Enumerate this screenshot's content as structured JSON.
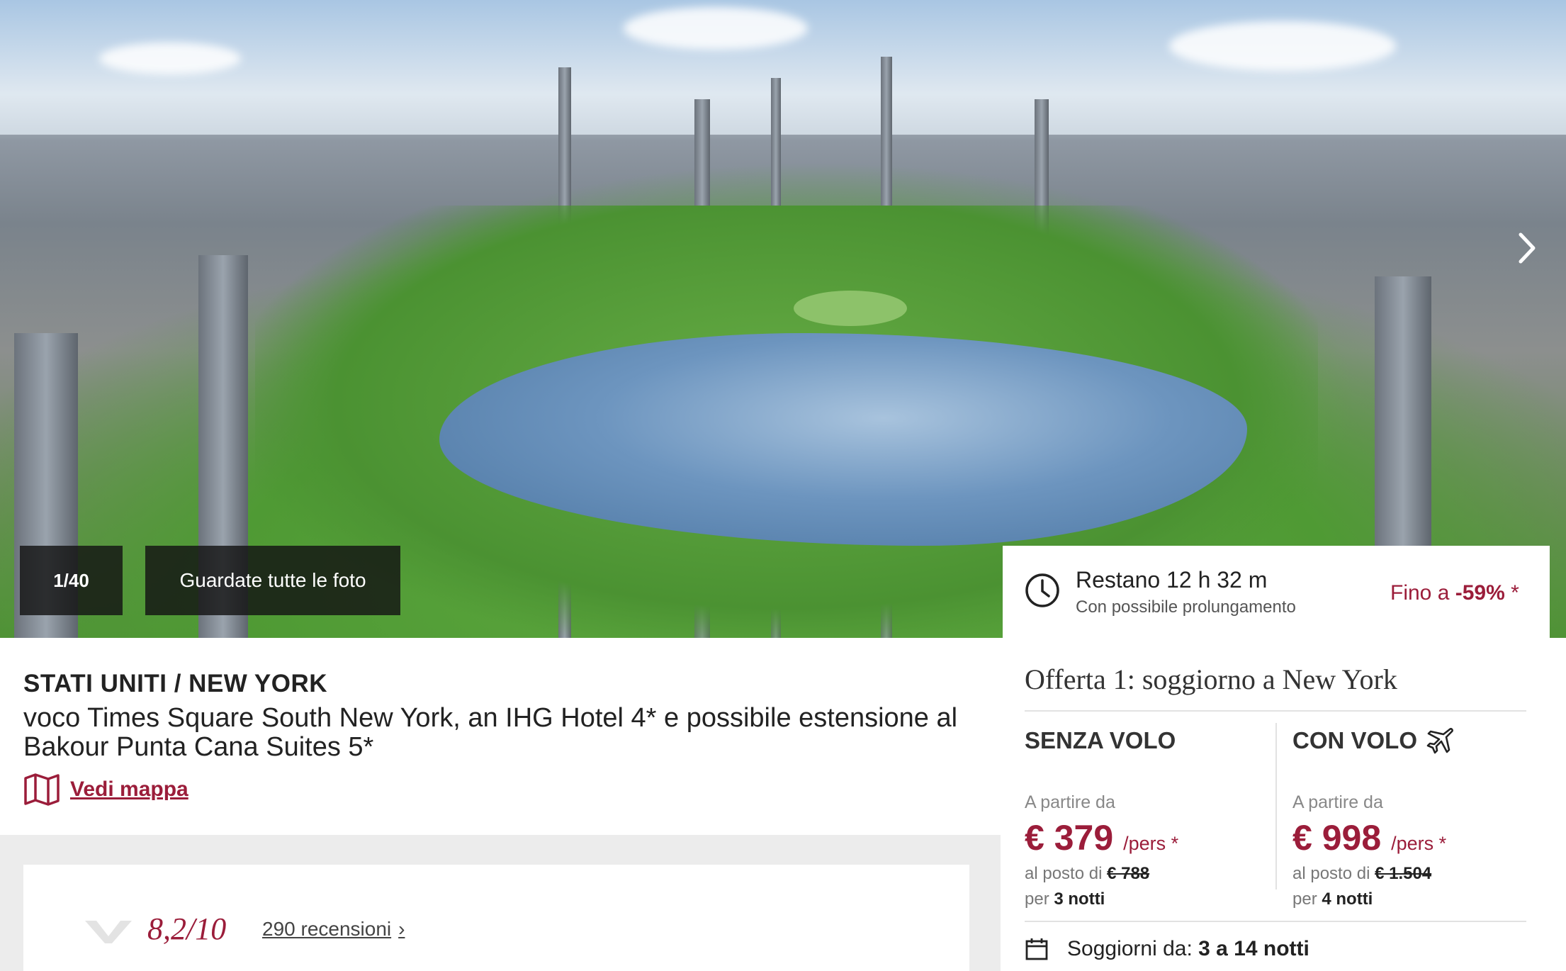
{
  "gallery": {
    "counter": "1/40",
    "all_photos_label": "Guardate tutte le foto",
    "next_icon": "chevron-right-icon"
  },
  "listing": {
    "destination": "STATI UNITI / NEW YORK",
    "hotel_name": "voco Times Square South New York, an IHG Hotel 4* e possibile estensione al Bakour Punta Cana Suites 5*",
    "map_label": "Vedi mappa",
    "map_icon": "map-icon"
  },
  "reviews": {
    "rating": "8,2/10",
    "count_label": "290 recensioni",
    "chevron": "›"
  },
  "timer": {
    "title": "Restano 12 h 32 m",
    "subtitle": "Con possibile prolungamento",
    "discount_prefix": "Fino a",
    "discount_value": "-59%",
    "discount_suffix": "*"
  },
  "offer": {
    "title": "Offerta 1: soggiorno a New York",
    "options": [
      {
        "title": "SENZA VOLO",
        "from_label": "A partire da",
        "price": "€ 379",
        "per": "/pers *",
        "instead_prefix": "al posto di",
        "old_price": "€ 788",
        "nights_prefix": "per",
        "nights": "3 notti"
      },
      {
        "title": "CON VOLO",
        "icon": "plane-icon",
        "from_label": "A partire da",
        "price": "€ 998",
        "per": "/pers *",
        "instead_prefix": "al posto di",
        "old_price": "€ 1.504",
        "nights_prefix": "per",
        "nights": "4 notti"
      }
    ],
    "stay_label": "Soggiorni da:",
    "stay_value": "3 a 14 notti"
  },
  "colors": {
    "accent": "#9b1d3a",
    "overlay": "#141414",
    "grey_band": "#ececec"
  }
}
